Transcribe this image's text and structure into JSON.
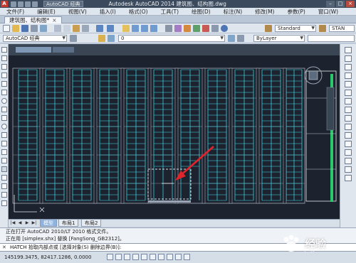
{
  "titlebar": {
    "logo": "A",
    "workspace": "AutoCAD 经典",
    "title": "Autodesk AutoCAD 2014    建筑图、结构图.dwg"
  },
  "menu": {
    "items": [
      "文件(F)",
      "编辑(E)",
      "视图(V)",
      "插入(I)",
      "格式(O)",
      "工具(T)",
      "绘图(D)",
      "标注(N)",
      "修改(M)",
      "参数(P)",
      "窗口(W)"
    ]
  },
  "document_tab": {
    "label": "建筑图、结构图*"
  },
  "toolbar": {
    "text_style": "Standard",
    "dim_style": "STAN",
    "workspace_combo": "AutoCAD 经典",
    "layer_combo": "0",
    "color_combo": "ByLayer"
  },
  "layout_tabs": {
    "items": [
      "模型",
      "布局1",
      "布局2"
    ],
    "active": 0
  },
  "command_history": [
    "正在打开 AutoCAD 2010/LT 2010 格式文件。",
    "正在用 [simplex.shx] 替换 [FangSong_GB2312]。"
  ],
  "command_line": {
    "text": "HATCH 拾取内部点或 [选择对象(S) 删除边界(B)]:"
  },
  "status": {
    "coords": "145199.3475, 82417.1286, 0.0000"
  },
  "watermark": {
    "text": "经验",
    "sub": "jingyan.baidu.com"
  },
  "colors": {
    "canvas_bg": "#1d232e",
    "drawing_lines": "#3fe2ee",
    "arrow": "#e0242c",
    "active_tab": "#8fb3df"
  }
}
